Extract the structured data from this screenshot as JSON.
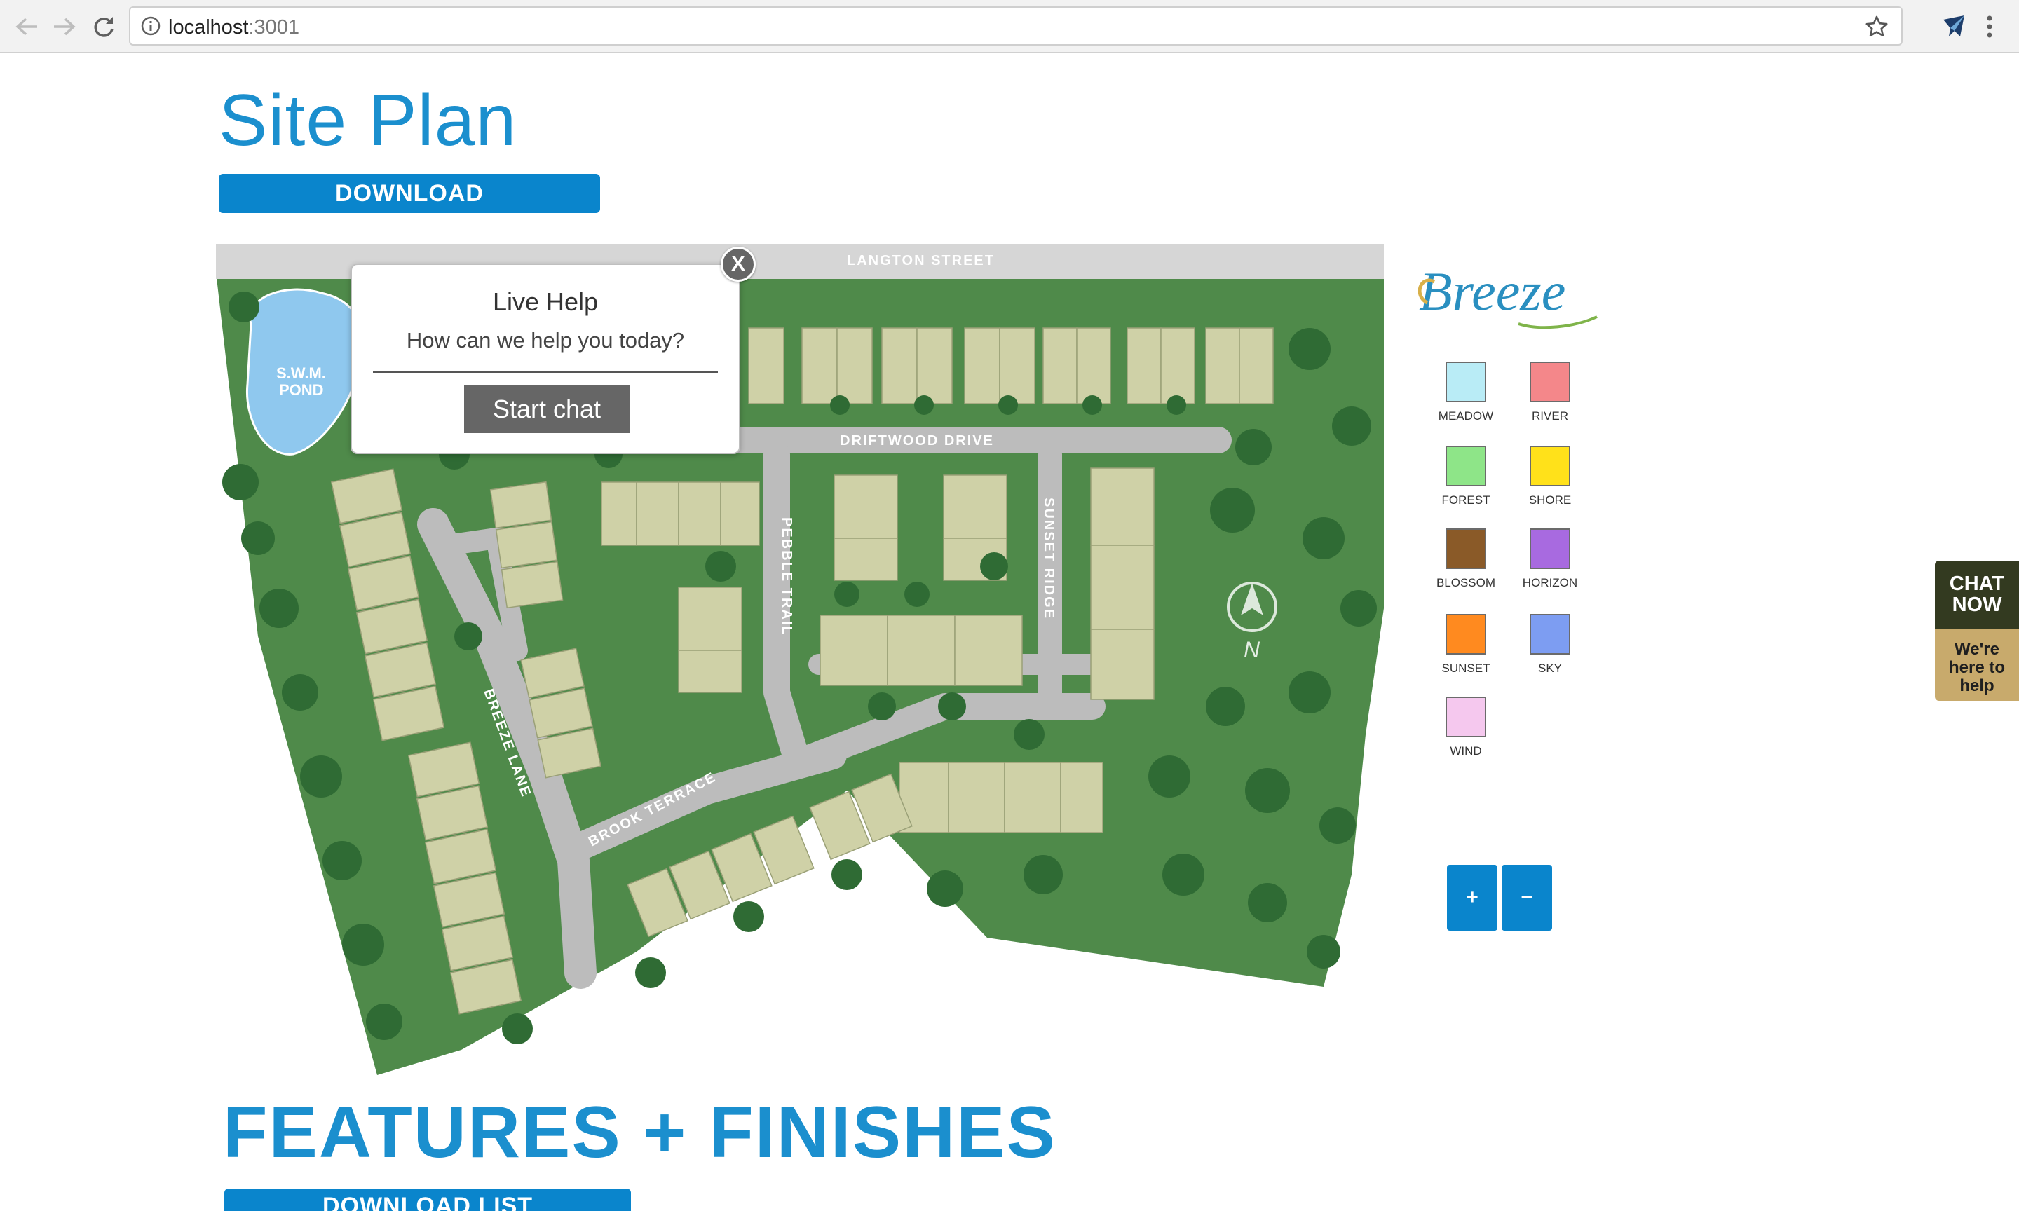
{
  "browser": {
    "url_host": "localhost",
    "url_port": ":3001",
    "icons": [
      "back-arrow-icon",
      "forward-arrow-icon",
      "reload-icon",
      "info-icon",
      "star-icon",
      "extension-icon",
      "menu-icon"
    ]
  },
  "page": {
    "title": "Site Plan",
    "download_label": "DOWNLOAD"
  },
  "sitemap": {
    "streets": {
      "langton": "LANGTON STREET",
      "driftwood": "DRIFTWOOD DRIVE",
      "pebble": "PEBBLE TRAIL",
      "sunset": "SUNSET RIDGE",
      "breeze": "BREEZE LANE",
      "brook": "BROOK TERRACE"
    },
    "pond_label_1": "S.W.M.",
    "pond_label_2": "POND",
    "north": "N",
    "colors": {
      "grass": "#4f8a4a",
      "road": "#bcbcbc",
      "lot": "#cfd1a7",
      "tree": "#2f6b34",
      "pond": "#8fc8ee"
    }
  },
  "live_help": {
    "close": "X",
    "title": "Live Help",
    "subtitle": "How can we help you today?",
    "button": "Start chat"
  },
  "legend": {
    "brand": "Breeze",
    "items": [
      {
        "label": "MEADOW",
        "color": "#b9ecf6"
      },
      {
        "label": "RIVER",
        "color": "#f4878a"
      },
      {
        "label": "FOREST",
        "color": "#8ee588"
      },
      {
        "label": "SHORE",
        "color": "#ffe11a"
      },
      {
        "label": "BLOSSOM",
        "color": "#8a5a28"
      },
      {
        "label": "HORIZON",
        "color": "#a86ae0"
      },
      {
        "label": "SUNSET",
        "color": "#ff8a1f"
      },
      {
        "label": "SKY",
        "color": "#7d9df2"
      },
      {
        "label": "WIND",
        "color": "#f5c8ee"
      }
    ]
  },
  "zoom": {
    "in": "+",
    "out": "−"
  },
  "chat": {
    "line1": "CHAT",
    "line2": "NOW",
    "line3": "We're",
    "line4": "here to",
    "line5": "help"
  },
  "features": {
    "title": "FEATURES + FINISHES",
    "download_list_label": "DOWNLOAD LIST"
  }
}
